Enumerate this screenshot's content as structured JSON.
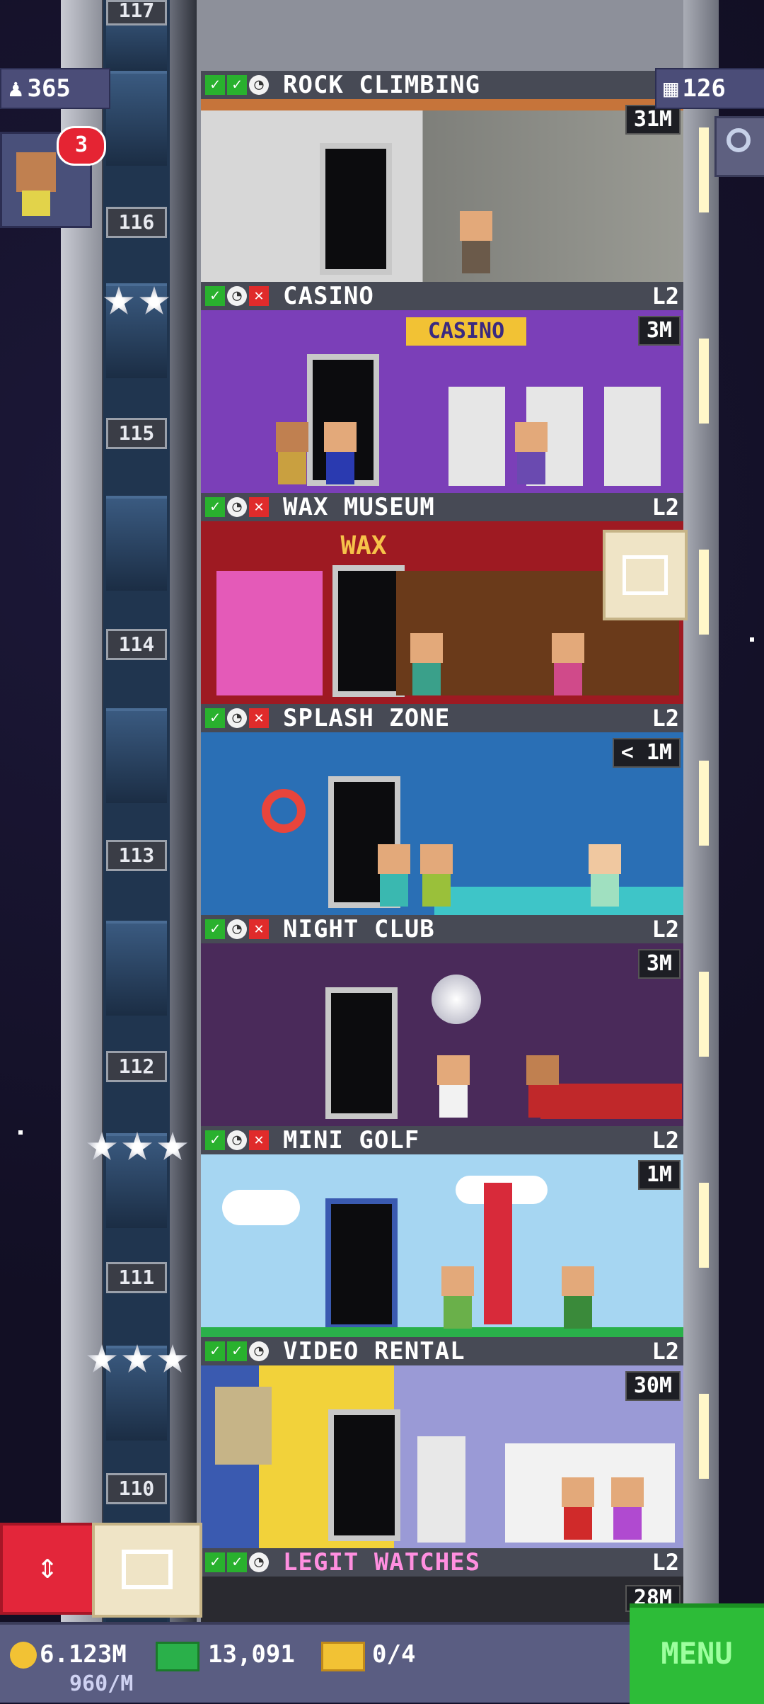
{
  "top": {
    "population": "365",
    "bux_level": "126",
    "visitor_badge": "3"
  },
  "floors": [
    {
      "num": "117",
      "name": "",
      "level": "",
      "time": ""
    },
    {
      "num": "116",
      "name": "ROCK CLIMBING",
      "level": "",
      "time": "31M",
      "stars": 0
    },
    {
      "num": "115",
      "name": "CASINO",
      "level": "L2",
      "time": "3M",
      "sign": "CASINO",
      "stars": 2
    },
    {
      "num": "114",
      "name": "WAX MUSEUM",
      "level": "L2",
      "time": "",
      "sign": "WAX"
    },
    {
      "num": "113",
      "name": "SPLASH ZONE",
      "level": "L2",
      "time": "< 1M"
    },
    {
      "num": "112",
      "name": "NIGHT CLUB",
      "level": "L2",
      "time": "3M"
    },
    {
      "num": "111",
      "name": "MINI GOLF",
      "level": "L2",
      "time": "1M",
      "stars": 3
    },
    {
      "num": "110",
      "name": "VIDEO RENTAL",
      "level": "L2",
      "time": "30M",
      "stars": 3
    },
    {
      "num": "",
      "name": "LEGIT WATCHES",
      "level": "L2",
      "time": "28M"
    }
  ],
  "bottom": {
    "coins": "6.123M",
    "bux": "13,091",
    "tickets": "0/4",
    "rate": "960/M",
    "menu_label": "MENU"
  },
  "colors": {
    "menu": "#2dbc38",
    "badge": "#e52433",
    "shaft": "#20354f"
  }
}
